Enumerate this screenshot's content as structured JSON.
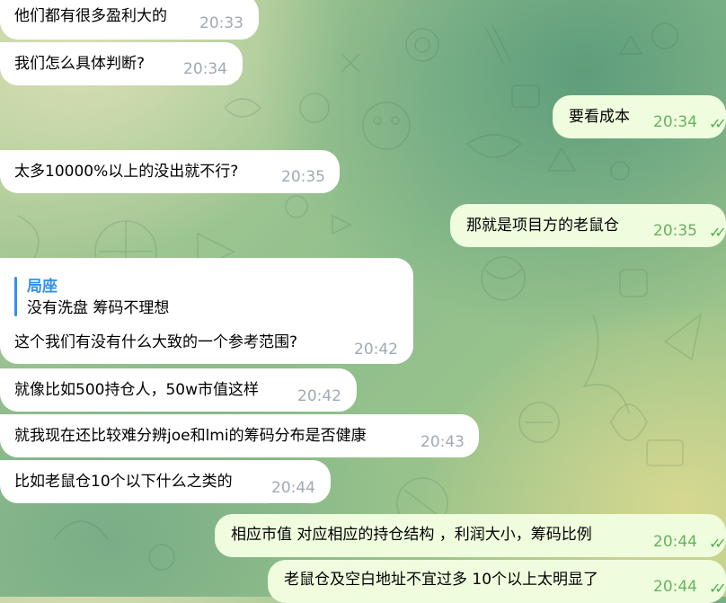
{
  "theme": {
    "incoming_bg": "#ffffff",
    "outgoing_bg": "#effdde",
    "time_in_color": "#a1aab3",
    "time_out_color": "#6ab15f",
    "reply_accent": "#3390ec"
  },
  "messages": [
    {
      "text": "他们都有很多盈利大的",
      "time": "20:33",
      "direction": "in"
    },
    {
      "text": "我们怎么具体判断?",
      "time": "20:34",
      "direction": "in"
    },
    {
      "text": "要看成本",
      "time": "20:34",
      "direction": "out",
      "status": "read-double-check"
    },
    {
      "text": "太多10000%以上的没出就不行?",
      "time": "20:35",
      "direction": "in"
    },
    {
      "text": "那就是项目方的老鼠仓",
      "time": "20:35",
      "direction": "out",
      "status": "read-double-check"
    },
    {
      "text": "这个我们有没有什么大致的一个参考范围?",
      "time": "20:42",
      "direction": "in",
      "reply": {
        "name": "局座",
        "text": "没有洗盘  筹码不理想"
      }
    },
    {
      "text": "就像比如500持仓人，50w市值这样",
      "time": "20:42",
      "direction": "in"
    },
    {
      "text": "就我现在还比较难分辨joe和lmi的筹码分布是否健康",
      "time": "20:43",
      "direction": "in"
    },
    {
      "text": "比如老鼠仓10个以下什么之类的",
      "time": "20:44",
      "direction": "in"
    },
    {
      "text": "相应市值  对应相应的持仓结构 ，利润大小，筹码比例",
      "time": "20:44",
      "direction": "out",
      "status": "read-double-check"
    },
    {
      "text": "老鼠仓及空白地址不宜过多  10个以上太明显了",
      "time": "20:44",
      "direction": "out",
      "status": "read-double-check"
    }
  ]
}
